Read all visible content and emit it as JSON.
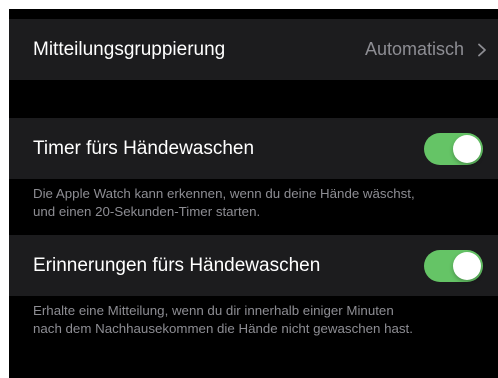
{
  "notifications": {
    "label": "Mitteilungsgruppierung",
    "value": "Automatisch"
  },
  "handwashing_timer": {
    "label": "Timer fürs Händewaschen",
    "enabled": true,
    "footer_line1": "Die Apple Watch kann erkennen, wenn du deine Hände wäschst,",
    "footer_line2": "und einen 20-Sekunden-Timer starten."
  },
  "handwashing_reminders": {
    "label": "Erinnerungen fürs Händewaschen",
    "enabled": true,
    "footer_line1": "Erhalte eine Mitteilung, wenn du dir innerhalb einiger Minuten",
    "footer_line2": "nach dem Nachhausekommen die Hände nicht gewaschen hast."
  },
  "colors": {
    "background": "#000000",
    "cell": "#1c1c1e",
    "secondary_text": "#8d8d93",
    "toggle_on": "#65c466"
  },
  "icons": {
    "disclosure": "chevron-right-icon"
  }
}
